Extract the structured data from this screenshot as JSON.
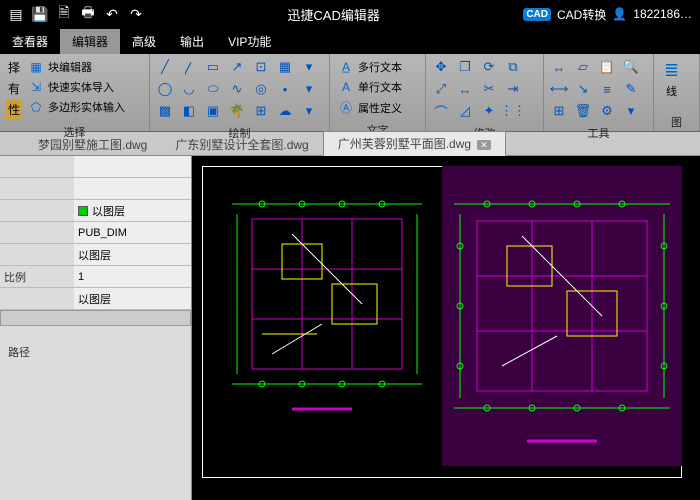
{
  "app": {
    "title": "迅捷CAD编辑器",
    "user": "1822186…",
    "convert": "CAD转换"
  },
  "qat": [
    "new",
    "save",
    "pdf",
    "print",
    "undo",
    "redo"
  ],
  "tabs": {
    "items": [
      "查看器",
      "编辑器",
      "高级",
      "输出",
      "VIP功能"
    ],
    "active": 1
  },
  "ribbon": {
    "select": {
      "label": "选择",
      "col1": [
        "择",
        "有",
        "性"
      ],
      "rows": [
        "块编辑器",
        "快速实体导入",
        "多边形实体输入"
      ]
    },
    "draw": {
      "label": "绘制"
    },
    "text": {
      "label": "文字",
      "rows": [
        "多行文本",
        "单行文本",
        "属性定义"
      ]
    },
    "modify": {
      "label": "修改"
    },
    "tool": {
      "label": "工具"
    },
    "layer": {
      "label": "图",
      "btn": "线"
    }
  },
  "docs": {
    "items": [
      "梦园别墅施工图.dwg",
      "广东别墅设计全套图.dwg",
      "广州芙蓉别墅平面图.dwg"
    ],
    "active": 2
  },
  "props": {
    "rows": [
      {
        "k": "",
        "v": ""
      },
      {
        "k": "",
        "v": ""
      },
      {
        "k": "",
        "v": "以图层",
        "swatch": true
      },
      {
        "k": "",
        "v": "PUB_DIM"
      },
      {
        "k": "",
        "v": "以图层"
      },
      {
        "k": "比例",
        "v": "1"
      },
      {
        "k": "",
        "v": "以图层"
      }
    ],
    "path_label": "路径"
  }
}
